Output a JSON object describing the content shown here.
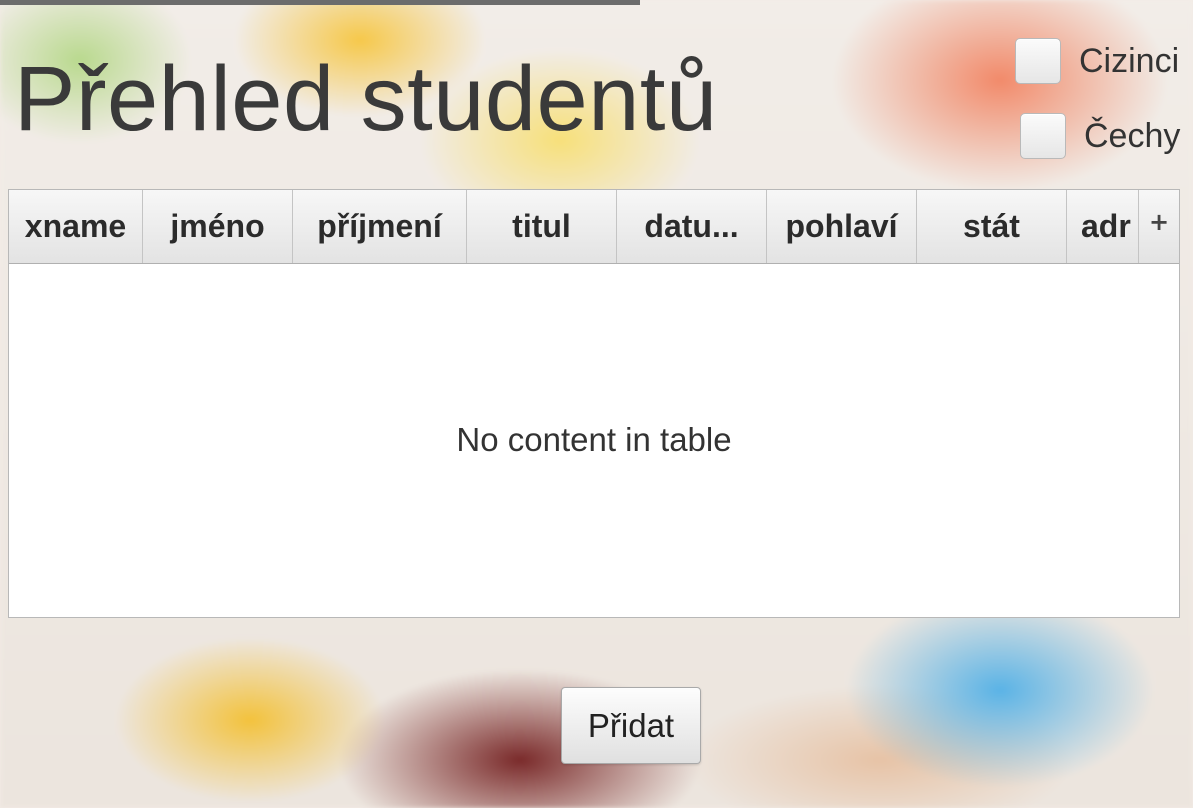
{
  "window": {
    "title": "Přehled studentů"
  },
  "filters": {
    "cizinci_label": "Cizinci",
    "cechy_label": "Čechy"
  },
  "table": {
    "columns": [
      "xname",
      "jméno",
      "příjmení",
      "titul",
      "datu...",
      "pohlaví",
      "stát",
      "adr"
    ],
    "column_menu_icon": "plus-icon",
    "column_menu_glyph": "+",
    "placeholder": "No content in table",
    "rows": []
  },
  "actions": {
    "add_label": "Přidat"
  }
}
